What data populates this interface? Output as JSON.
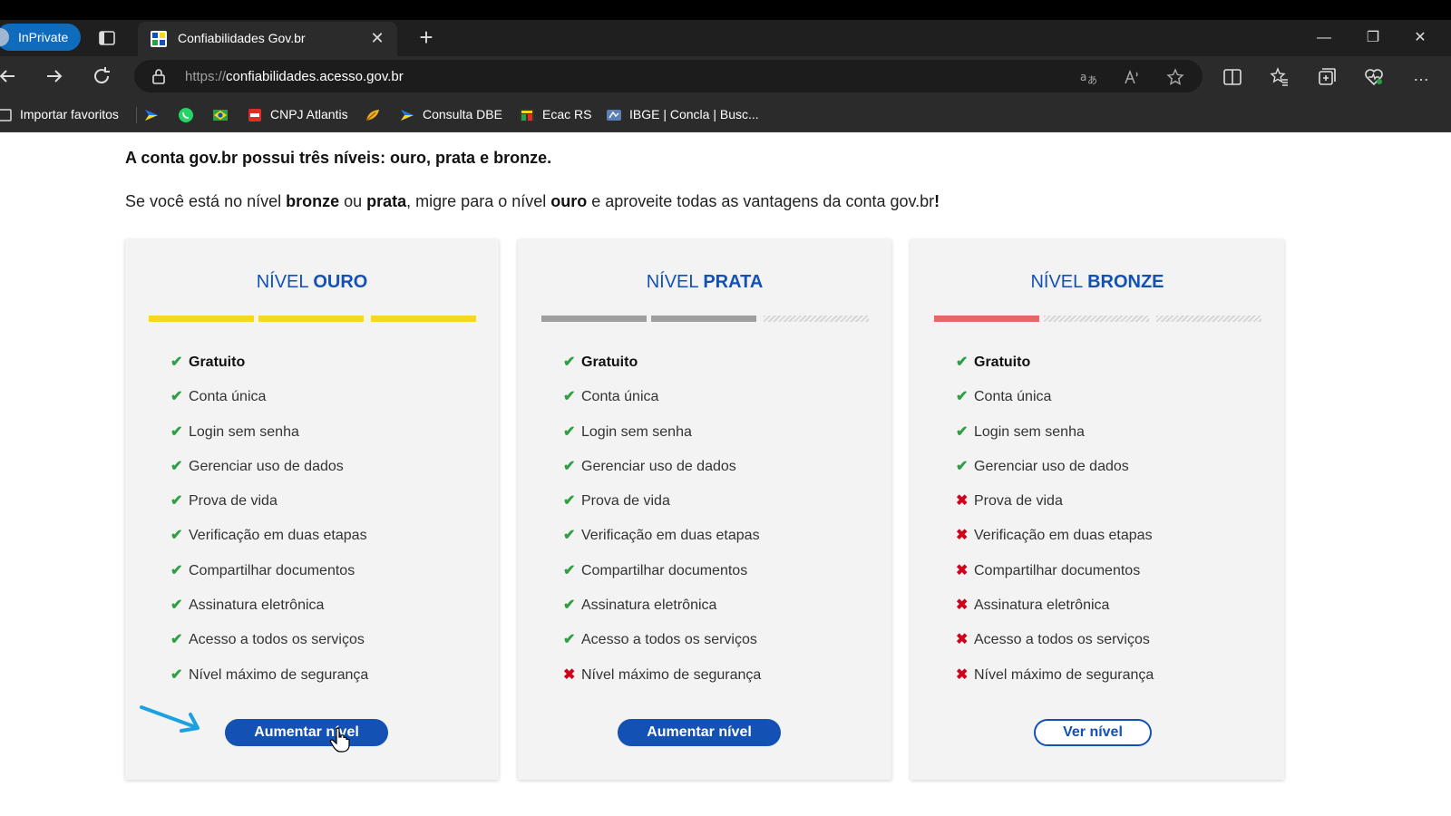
{
  "browser": {
    "inprivate_label": "InPrivate",
    "tab": {
      "title": "Confiabilidades Gov.br",
      "close": "✕"
    },
    "new_tab": "+",
    "window_controls": {
      "minimize": "—",
      "restore": "❐",
      "close": "✕"
    },
    "address": {
      "protocol": "https://",
      "host": "confiabilidades.acesso.gov.br"
    },
    "favorites": [
      {
        "label": "Importar favoritos",
        "icon": "import-icon"
      },
      {
        "label": "",
        "icon": "gov-arrow-icon"
      },
      {
        "label": "",
        "icon": "whatsapp-icon"
      },
      {
        "label": "",
        "icon": "brazil-flag-icon"
      },
      {
        "label": "CNPJ Atlantis",
        "icon": "pdf-icon"
      },
      {
        "label": "",
        "icon": "leaf-icon"
      },
      {
        "label": "Consulta DBE",
        "icon": "gov-arrow-icon"
      },
      {
        "label": "Ecac RS",
        "icon": "sefaz-icon"
      },
      {
        "label": "IBGE | Concla | Busc...",
        "icon": "ibge-icon"
      }
    ]
  },
  "page": {
    "intro": "A conta gov.br possui três níveis: ouro, prata e bronze.",
    "intro2": {
      "p1": "Se você está no nível ",
      "b1": "bronze",
      "p2": " ou ",
      "b2": "prata",
      "p3": ", migre para o nível ",
      "b3": "ouro",
      "p4": " e aproveite todas as vantagens da conta gov.br",
      "end": "!"
    },
    "cards": [
      {
        "prefix": "NÍVEL ",
        "level": "OURO",
        "bar_color": "#f9d71c",
        "filled_segments": 3,
        "button": "Aumentar nível",
        "features": [
          {
            "label": "Gratuito",
            "ok": true
          },
          {
            "label": "Conta única",
            "ok": true
          },
          {
            "label": "Login sem senha",
            "ok": true
          },
          {
            "label": "Gerenciar uso de dados",
            "ok": true
          },
          {
            "label": "Prova de vida",
            "ok": true
          },
          {
            "label": "Verificação em duas etapas",
            "ok": true
          },
          {
            "label": "Compartilhar documentos",
            "ok": true
          },
          {
            "label": "Assinatura eletrônica",
            "ok": true
          },
          {
            "label": "Acesso a todos os serviços",
            "ok": true
          },
          {
            "label": "Nível máximo de segurança",
            "ok": true
          }
        ]
      },
      {
        "prefix": "NÍVEL ",
        "level": "PRATA",
        "bar_color": "#9e9e9e",
        "filled_segments": 2,
        "button": "Aumentar nível",
        "features": [
          {
            "label": "Gratuito",
            "ok": true
          },
          {
            "label": "Conta única",
            "ok": true
          },
          {
            "label": "Login sem senha",
            "ok": true
          },
          {
            "label": "Gerenciar uso de dados",
            "ok": true
          },
          {
            "label": "Prova de vida",
            "ok": true
          },
          {
            "label": "Verificação em duas etapas",
            "ok": true
          },
          {
            "label": "Compartilhar documentos",
            "ok": true
          },
          {
            "label": "Assinatura eletrônica",
            "ok": true
          },
          {
            "label": "Acesso a todos os serviços",
            "ok": true
          },
          {
            "label": "Nível máximo de segurança",
            "ok": false
          }
        ]
      },
      {
        "prefix": "NÍVEL ",
        "level": "BRONZE",
        "bar_color": "#e56767",
        "filled_segments": 1,
        "button": "Ver nível",
        "features": [
          {
            "label": "Gratuito",
            "ok": true
          },
          {
            "label": "Conta única",
            "ok": true
          },
          {
            "label": "Login sem senha",
            "ok": true
          },
          {
            "label": "Gerenciar uso de dados",
            "ok": true
          },
          {
            "label": "Prova de vida",
            "ok": false
          },
          {
            "label": "Verificação em duas etapas",
            "ok": false
          },
          {
            "label": "Compartilhar documentos",
            "ok": false
          },
          {
            "label": "Assinatura eletrônica",
            "ok": false
          },
          {
            "label": "Acesso a todos os serviços",
            "ok": false
          },
          {
            "label": "Nível máximo de segurança",
            "ok": false
          }
        ]
      }
    ]
  },
  "colors": {
    "gov_blue": "#1351b4",
    "check": "#2ea043",
    "cross": "#d0021b",
    "arrow": "#1ba1e2"
  }
}
